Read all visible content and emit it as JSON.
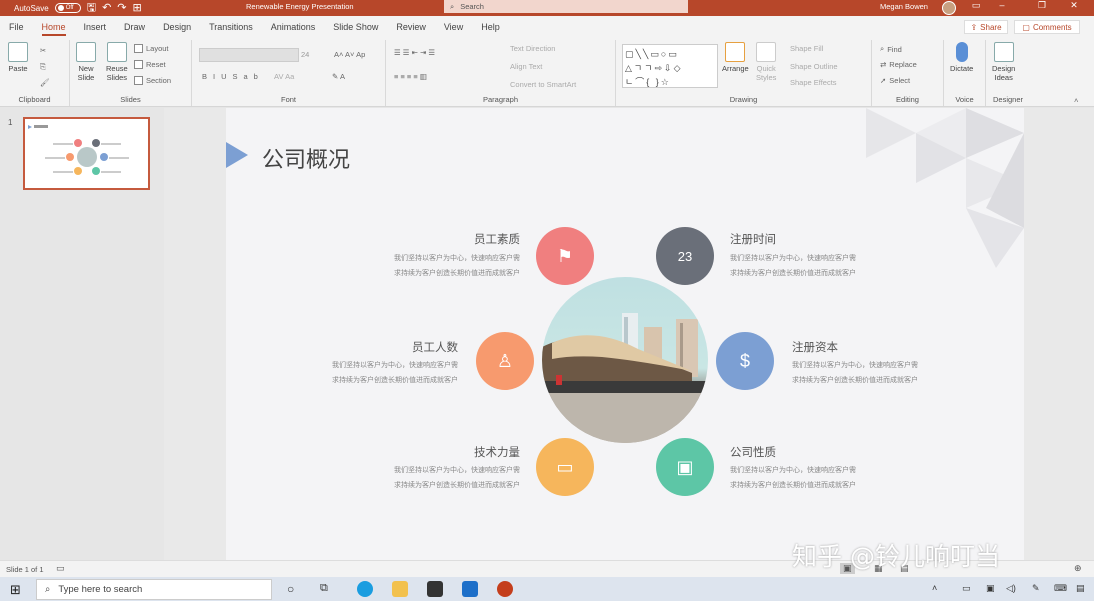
{
  "titlebar": {
    "autosave_label": "AutoSave",
    "autosave_state": "Off",
    "doc_title": "Renewable Energy Presentation",
    "search_placeholder": "Search",
    "user_name": "Megan Bowen"
  },
  "tabs": [
    "File",
    "Home",
    "Insert",
    "Draw",
    "Design",
    "Transitions",
    "Animations",
    "Slide Show",
    "Review",
    "View",
    "Help"
  ],
  "share_label": "Share",
  "comments_label": "Comments",
  "ribbon": {
    "clipboard": {
      "paste": "Paste",
      "label": "Clipboard"
    },
    "slides": {
      "new_slide_1": "New",
      "new_slide_2": "Slide",
      "reuse_1": "Reuse",
      "reuse_2": "Slides",
      "layout": "Layout",
      "reset": "Reset",
      "section": "Section",
      "label": "Slides"
    },
    "font": {
      "size": "24",
      "label": "Font"
    },
    "paragraph": {
      "text_direction": "Text Direction",
      "align_text": "Align Text",
      "convert": "Convert to SmartArt",
      "label": "Paragraph"
    },
    "drawing": {
      "arrange": "Arrange",
      "quick_1": "Quick",
      "quick_2": "Styles",
      "shape_fill": "Shape Fill",
      "shape_outline": "Shape Outline",
      "shape_effects": "Shape Effects",
      "label": "Drawing"
    },
    "editing": {
      "find": "Find",
      "replace": "Replace",
      "select": "Select",
      "label": "Editing"
    },
    "voice": {
      "dictate": "Dictate",
      "label": "Voice"
    },
    "designer": {
      "ideas_1": "Design",
      "ideas_2": "Ideas",
      "label": "Designer"
    }
  },
  "thumb_number": "1",
  "slide": {
    "title": "公司概况",
    "items": [
      {
        "title": "员工素质",
        "desc1": "我们坚持以客户为中心，快速响应客户需",
        "desc2": "求持续为客户创造长期价值进而成就客户",
        "color": "#f07f7f",
        "icon": "flag-icon",
        "glyph": "⚑"
      },
      {
        "title": "注册时间",
        "desc1": "我们坚持以客户为中心，快速响应客户需",
        "desc2": "求持续为客户创造长期价值进而成就客户",
        "color": "#6a6f79",
        "icon": "calendar-icon",
        "glyph": "23"
      },
      {
        "title": "员工人数",
        "desc1": "我们坚持以客户为中心，快速响应客户需",
        "desc2": "求持续为客户创造长期价值进而成就客户",
        "color": "#f79a6e",
        "icon": "user-icon",
        "glyph": "♙"
      },
      {
        "title": "注册资本",
        "desc1": "我们坚持以客户为中心，快速响应客户需",
        "desc2": "求持续为客户创造长期价值进而成就客户",
        "color": "#7c9fd3",
        "icon": "dollar-icon",
        "glyph": "$"
      },
      {
        "title": "技术力量",
        "desc1": "我们坚持以客户为中心，快速响应客户需",
        "desc2": "求持续为客户创造长期价值进而成就客户",
        "color": "#f6b65c",
        "icon": "battery-icon",
        "glyph": "▭"
      },
      {
        "title": "公司性质",
        "desc1": "我们坚持以客户为中心，快速响应客户需",
        "desc2": "求持续为客户创造长期价值进而成就客户",
        "color": "#5dc6a6",
        "icon": "wallet-icon",
        "glyph": "▣"
      }
    ]
  },
  "status": {
    "slide_count": "Slide 1 of 1"
  },
  "watermark": "知乎 @铃儿响叮当",
  "taskbar": {
    "search_placeholder": "Type here to search"
  }
}
